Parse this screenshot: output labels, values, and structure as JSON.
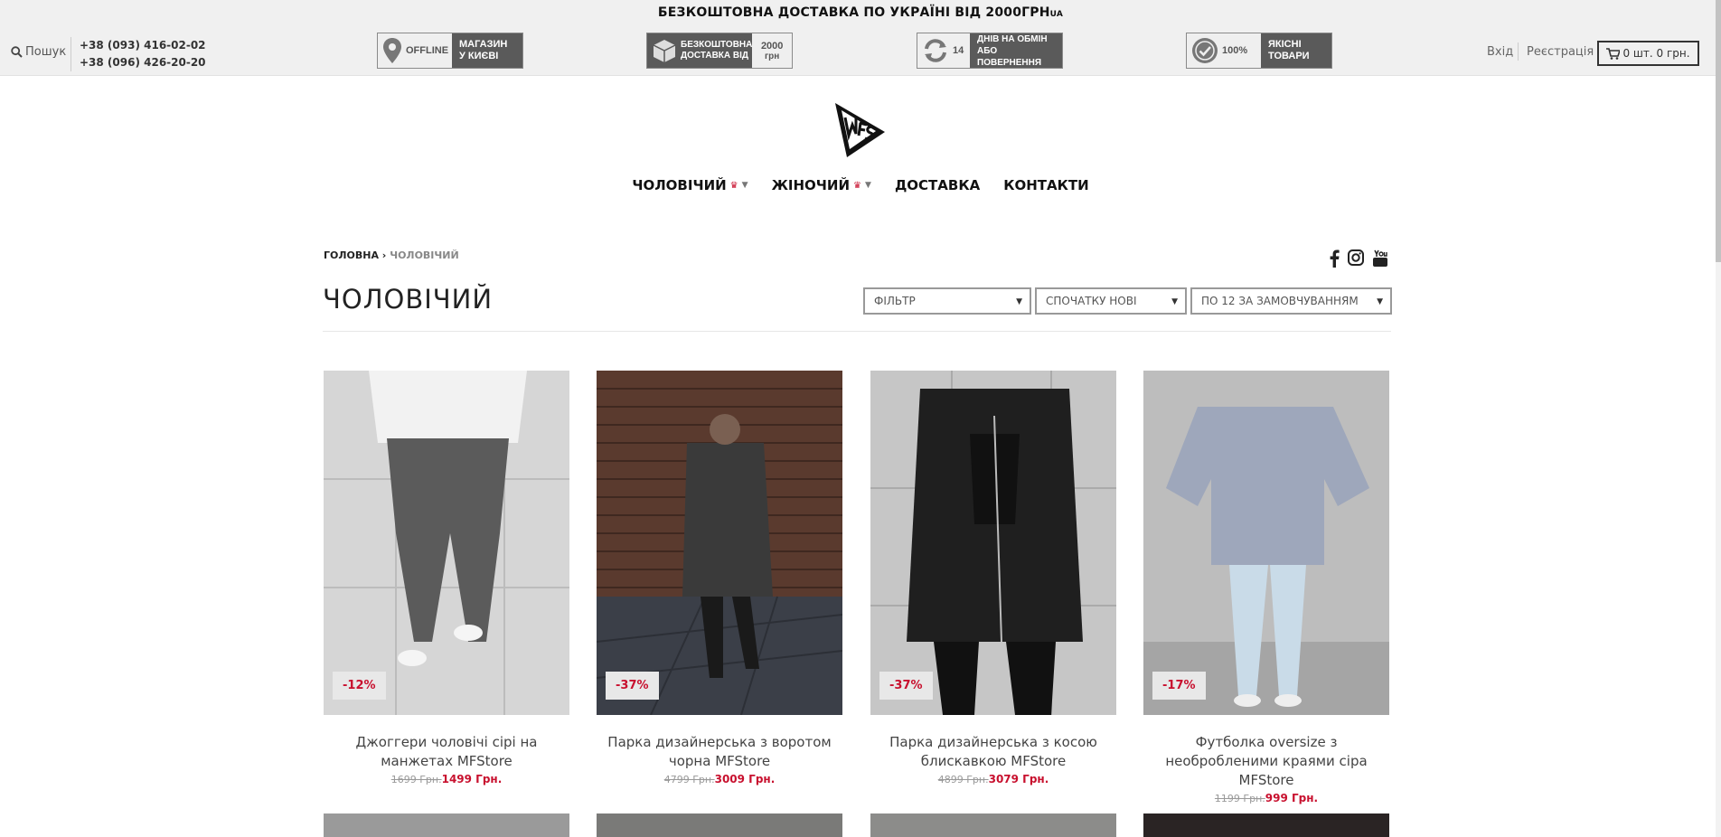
{
  "promo": {
    "text": "БЕЗКОШТОВНА ДОСТАВКА ПО УКРАЇНІ ВІД 2000ГРН",
    "sup": "UA"
  },
  "header": {
    "search_label": "Пошук",
    "phone1": "+38 (093) 416-02-02",
    "phone2": "+38 (096) 426-20-20",
    "login": "Вхід",
    "register": "Реєстрація",
    "cart": "0 шт. 0 грн."
  },
  "badges": [
    {
      "left": "OFFLINE",
      "right1": "МАГАЗИН",
      "right2": "У КИЄВІ"
    },
    {
      "left1": "БЕЗКОШТОВНА",
      "left2": "ДОСТАВКА ВІД",
      "right1": "2000",
      "right2": "грн"
    },
    {
      "left": "14",
      "right1": "ДНІВ НА ОБМІН",
      "right2": "АБО ПОВЕРНЕННЯ"
    },
    {
      "left": "100%",
      "right1": "ЯКІСНІ",
      "right2": "ТОВАРИ"
    }
  ],
  "nav": [
    {
      "label": "ЧОЛОВІЧИЙ"
    },
    {
      "label": "ЖІНОЧИЙ"
    },
    {
      "label": "ДОСТАВКА"
    },
    {
      "label": "КОНТАКТИ"
    }
  ],
  "breadcrumb": {
    "home": "ГОЛОВНА",
    "sep": "›",
    "current": "ЧОЛОВІЧИЙ"
  },
  "page": {
    "title": "ЧОЛОВІЧИЙ"
  },
  "filters": {
    "filter": "ФІЛЬТР",
    "sort": "СПОЧАТКУ НОВІ",
    "per_page": "ПО 12 ЗА ЗАМОВЧУВАННЯМ"
  },
  "products": [
    {
      "discount": "-12%",
      "name": "Джоггери чоловічі сірі на манжетах MFStore",
      "old_price": "1699 Грн.",
      "price": "1499 Грн."
    },
    {
      "discount": "-37%",
      "name": "Парка дизайнерська з воротом чорна MFStore",
      "old_price": "4799 Грн.",
      "price": "3009 Грн."
    },
    {
      "discount": "-37%",
      "name": "Парка дизайнерська з косою блискавкою MFStore",
      "old_price": "4899 Грн.",
      "price": "3079 Грн."
    },
    {
      "discount": "-17%",
      "name": "Футболка oversize з необробленими краями сіра MFStore",
      "old_price": "1199 Грн.",
      "price": "999 Грн."
    }
  ],
  "colors": {
    "accent": "#c8102e",
    "badge_dark": "#5a5a5a",
    "topbar": "#f0f0f0"
  }
}
